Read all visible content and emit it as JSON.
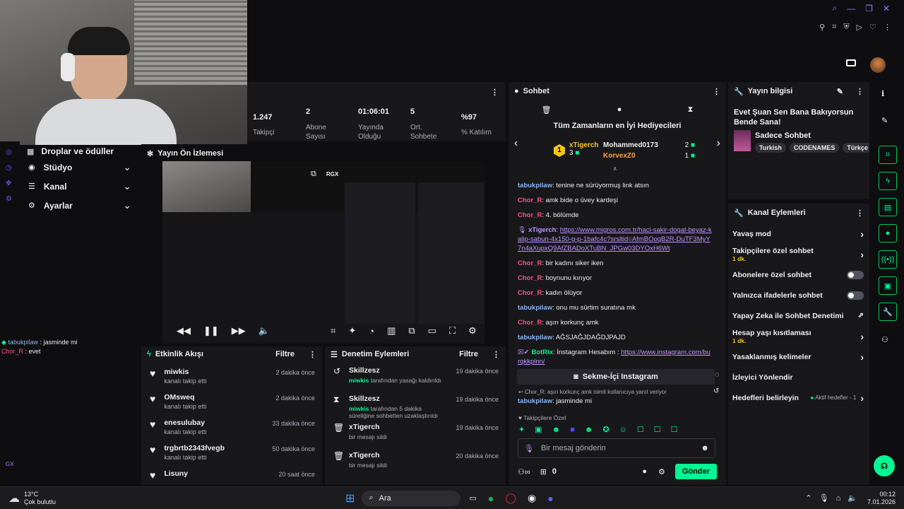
{
  "stats": [
    {
      "v": "1.247",
      "l": "Takipçi"
    },
    {
      "v": "2",
      "l": "Abone Sayısı"
    },
    {
      "v": "01:06:01",
      "l": "Yayında Olduğu"
    },
    {
      "v": "5",
      "l": "Ort. Sohbete"
    },
    {
      "v": "%97",
      "l": "% Katılım"
    }
  ],
  "sidebar": {
    "items": [
      "Droplar ve ödüller",
      "Stüdyo",
      "Kanal",
      "Ayarlar"
    ]
  },
  "preview": {
    "title": "Yayın Ön İzlemesi",
    "rgx": "RGX"
  },
  "activity": {
    "title": "Etkinlik Akışı",
    "filter": "Filtre",
    "items": [
      {
        "name": "miwkis",
        "desc": "kanalı takip etti",
        "time": "2 dakika önce"
      },
      {
        "name": "OMsweq",
        "desc": "kanalı takip etti",
        "time": "2 dakika önce"
      },
      {
        "name": "enesulubay",
        "desc": "kanalı takip etti",
        "time": "33 dakika önce"
      },
      {
        "name": "trgbrtb2343fvegb",
        "desc": "kanalı takip etti",
        "time": "50 dakika önce"
      },
      {
        "name": "Lisuny",
        "desc": "",
        "time": "20 saat önce"
      }
    ]
  },
  "mod": {
    "title": "Denetim Eylemleri",
    "filter": "Filtre",
    "items": [
      {
        "name": "Skillzesz",
        "who": "miwkis",
        "desc": " tarafından yasağı kaldırıldı",
        "time": "19 dakika önce",
        "icon": "↺"
      },
      {
        "name": "Skillzesz",
        "who": "miwkis",
        "desc": " tarafından 5 dakika süreliğine sohbetten uzaklaştırıldı",
        "time": "19 dakika önce",
        "icon": "⧗"
      },
      {
        "name": "xTigerch",
        "who": "",
        "desc": "bir mesajı sildi",
        "time": "19 dakika önce",
        "icon": "🗑"
      },
      {
        "name": "xTigerch",
        "who": "",
        "desc": "bir mesajı sildi",
        "time": "20 dakika önce",
        "icon": "🗑"
      }
    ]
  },
  "chat": {
    "title": "Sohbet",
    "gifters_title": "Tüm Zamanların en İyi Hediyecileri",
    "gifters": [
      {
        "rank": "1",
        "name": "xTigerch",
        "count": "3"
      },
      {
        "rank": "",
        "name": "Mohammed0173",
        "count": "2"
      },
      {
        "rank": "",
        "name": "KorvexZ0",
        "count": "1"
      }
    ],
    "messages": [
      {
        "user": "tabukpilaw",
        "color": "#8ab4f8",
        "text": ": tenine ne sürüyormuş link atsın"
      },
      {
        "user": "Chor_R",
        "color": "#ff4f8b",
        "text": ": amk bide o üvey kardeşi"
      },
      {
        "user": "Chor_R",
        "color": "#ff4f8b",
        "text": ": 4. bölümde"
      },
      {
        "user": "xTigerch",
        "color": "#bf94ff",
        "text": ": ",
        "link": "https://www.migros.com.tr/haci-sakir-dogal-beyaz-kalip-sabun-4x150-g-p-1bafc4c?srsltid=AfmBOoqB2R-DuTF3MyY7n4aXupxQ9AfZBADoXTuBN_JPGw03DYOxH6Wt"
      },
      {
        "user": "Chor_R",
        "color": "#ff4f8b",
        "text": ": bir kadını siker iken"
      },
      {
        "user": "Chor_R",
        "color": "#ff4f8b",
        "text": ": boynunu kırıyor"
      },
      {
        "user": "Chor_R",
        "color": "#ff4f8b",
        "text": ": kadın ölüyor"
      },
      {
        "user": "tabukpilaw",
        "color": "#8ab4f8",
        "text": ": onu mu sürtim suratına mk"
      },
      {
        "user": "Chor_R",
        "color": "#ff4f8b",
        "text": ": aşırı korkunç amk"
      },
      {
        "user": "tabukpilaw",
        "color": "#8ab4f8",
        "text": ": AĞSJAĞJDAĞDJPAJD"
      },
      {
        "user": "BotRix",
        "color": "#00f593",
        "text": ": İnstagram Hesabım : ",
        "link": "https://www.instagram.com/burqkkplnn/"
      }
    ],
    "sekme": "Sekme-İçi Instagram",
    "reply_note": "Chor_R: aşırı korkunç amk isimli kullanıcıya yanıt veriyor",
    "reply": {
      "user": "tabukpilaw",
      "text": ": jasminde mi"
    },
    "followers_only": "Takipçilere Özel",
    "placeholder": "Bir mesaj gönderin",
    "points": "0",
    "send": "Gönder"
  },
  "info": {
    "title": "Yayın bilgisi",
    "stream_title": "Evet Şuan Sen Bana Bakıyorsun Bende Sana!",
    "category": "Sadece Sohbet",
    "tags": [
      "Turkish",
      "CODENAMES",
      "Türkçe"
    ]
  },
  "actions": {
    "title": "Kanal Eylemleri",
    "items": [
      {
        "label": "Yavaş mod",
        "sub": "",
        "kind": "chev"
      },
      {
        "label": "Takipçilere özel sohbet",
        "sub": "1 dk.",
        "kind": "chev"
      },
      {
        "label": "Abonelere özel sohbet",
        "sub": "",
        "kind": "toggle"
      },
      {
        "label": "Yalnızca ifadelerle sohbet",
        "sub": "",
        "kind": "toggle"
      },
      {
        "label": "Yapay Zeka ile Sohbet Denetimi",
        "sub": "",
        "kind": "ext"
      },
      {
        "label": "Hesap yaşı kısıtlaması",
        "sub": "1 dk.",
        "kind": "chev"
      },
      {
        "label": "Yasaklanmış kelimeler",
        "sub": "",
        "kind": "chev"
      },
      {
        "label": "İzleyici Yönlendir",
        "sub": "",
        "kind": "none"
      },
      {
        "label": "Hedefleri belirleyin",
        "sub": "",
        "kind": "goal",
        "extra": "Aktif hedefler - 1"
      }
    ]
  },
  "overlay_chat": [
    {
      "user": "tabukpilaw",
      "text": " : jasminde mi",
      "color": "#8ab4f8"
    },
    {
      "user": "Chor_R",
      "text": " : evet",
      "color": "#ff4f8b"
    }
  ],
  "taskbar": {
    "temp": "13°C",
    "weather": "Çok bulutlu",
    "search": "Ara",
    "time": "00:12",
    "date": "7.01.2026"
  },
  "gx": "GX"
}
